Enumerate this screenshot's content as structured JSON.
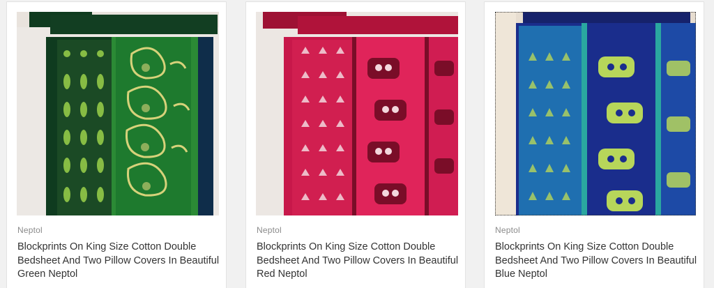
{
  "products": [
    {
      "brand": "Neptol",
      "title": "Blockprints On King Size Cotton Double Bedsheet And Two Pillow Covers In Beautiful Green Neptol",
      "colors": {
        "base": "#0f3b1f",
        "panel": "#1e7a2e",
        "print": "#9ad14a",
        "accent": "#d7d27a"
      }
    },
    {
      "brand": "Neptol",
      "title": "Blockprints On King Size Cotton Double Bedsheet And Two Pillow Covers In Beautiful Red Neptol",
      "colors": {
        "base": "#b0133a",
        "panel": "#e0245a",
        "print": "#f3d7dd",
        "accent": "#7a0d28"
      }
    },
    {
      "brand": "Neptol",
      "title": "Blockprints On King Size Cotton Double Bedsheet And Two Pillow Covers In Beautiful Blue Neptol",
      "colors": {
        "base": "#1a2d8c",
        "panel": "#1f6fb0",
        "print": "#b7d65a",
        "accent": "#2aa7a0"
      }
    }
  ]
}
